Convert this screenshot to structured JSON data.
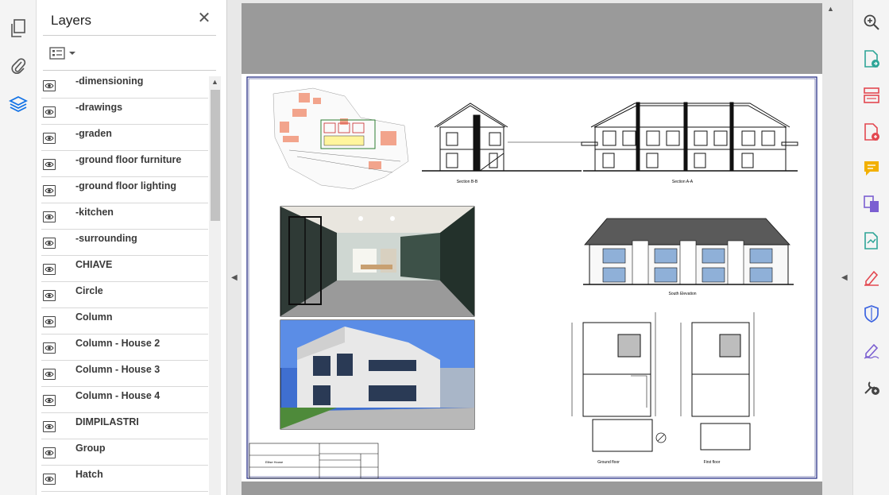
{
  "panel": {
    "title": "Layers",
    "close_symbol": "✕"
  },
  "left_rail": [
    {
      "icon": "pages-icon"
    },
    {
      "icon": "attachment-icon"
    },
    {
      "icon": "layers-icon",
      "active": true
    }
  ],
  "layers": [
    {
      "label": "-dimensioning",
      "visible": true
    },
    {
      "label": "-drawings",
      "visible": true
    },
    {
      "label": "-graden",
      "visible": true
    },
    {
      "label": "-ground floor furniture",
      "visible": true
    },
    {
      "label": "-ground floor lighting",
      "visible": true
    },
    {
      "label": "-kitchen",
      "visible": true
    },
    {
      "label": "-surrounding",
      "visible": true
    },
    {
      "label": "CHIAVE",
      "visible": true
    },
    {
      "label": "Circle",
      "visible": true
    },
    {
      "label": "Column",
      "visible": true
    },
    {
      "label": "Column - House 2",
      "visible": true
    },
    {
      "label": "Column - House 3",
      "visible": true
    },
    {
      "label": "Column - House 4",
      "visible": true
    },
    {
      "label": "DIMPILASTRI",
      "visible": true
    },
    {
      "label": "Group",
      "visible": true
    },
    {
      "label": "Hatch",
      "visible": true
    }
  ],
  "drawing": {
    "section_bb": "Section B-B",
    "section_aa": "Section A-A",
    "south_elevation": "South Elevation",
    "ground_floor": "Ground floor",
    "first_floor": "First floor",
    "title_block": {
      "project_label": "Ellise House"
    }
  },
  "right_rail": [
    {
      "icon": "zoom-in-icon"
    },
    {
      "icon": "export-pdf-icon"
    },
    {
      "icon": "organize-pages-icon"
    },
    {
      "icon": "create-pdf-icon"
    },
    {
      "icon": "comment-icon"
    },
    {
      "icon": "combine-files-icon"
    },
    {
      "icon": "enhance-scans-icon"
    },
    {
      "icon": "fill-sign-icon"
    },
    {
      "icon": "protect-icon"
    },
    {
      "icon": "request-signature-icon"
    },
    {
      "icon": "more-tools-icon"
    }
  ],
  "colors": {
    "accent_blue": "#1473e6",
    "tool_teal": "#2ea597",
    "tool_red": "#e34850",
    "tool_yellow": "#f2b000",
    "tool_purple": "#7b5fd1"
  }
}
